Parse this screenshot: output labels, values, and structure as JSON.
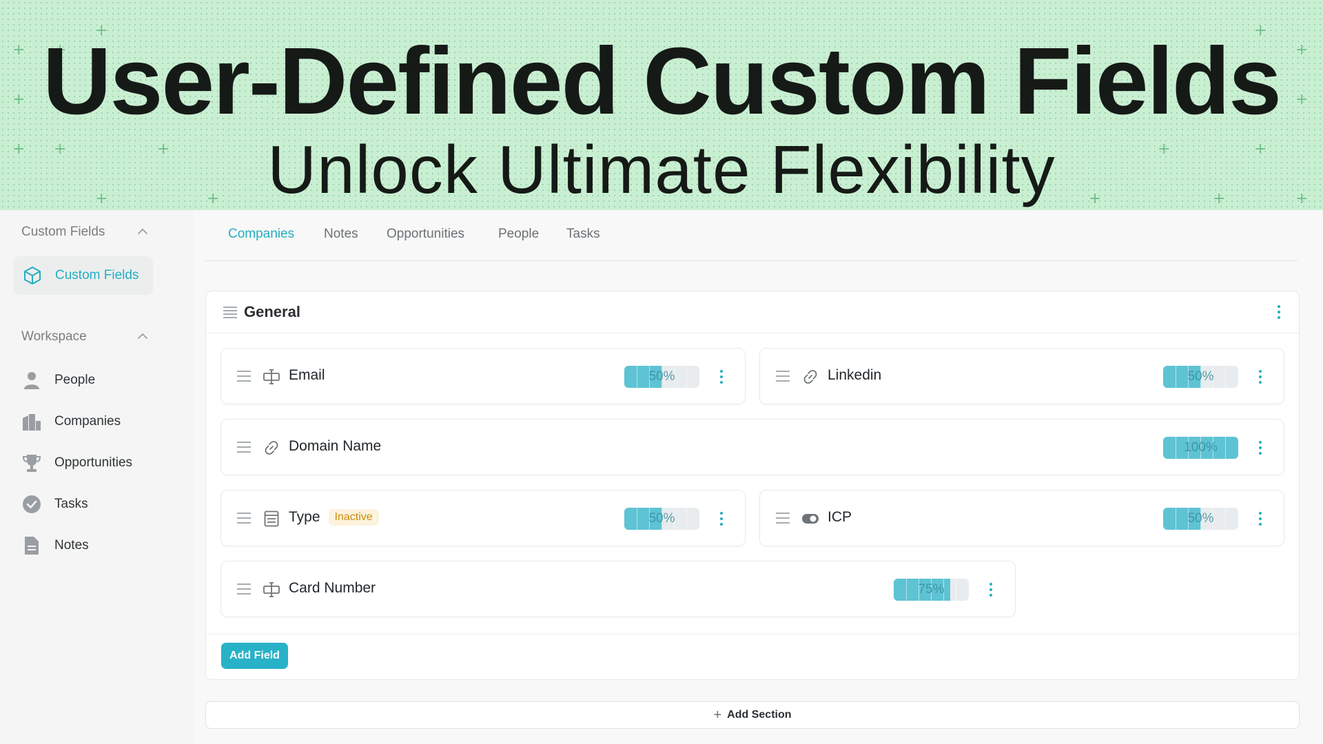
{
  "hero": {
    "title": "User-Defined Custom Fields",
    "subtitle": "Unlock Ultimate Flexibility"
  },
  "sidebar": {
    "groups": [
      {
        "label": "Custom Fields",
        "expanded": true
      },
      {
        "label": "Workspace",
        "expanded": true
      }
    ],
    "active_item": {
      "label": "Custom Fields",
      "icon": "cube-icon"
    },
    "items": [
      {
        "label": "People",
        "icon": "person-icon"
      },
      {
        "label": "Companies",
        "icon": "building-icon"
      },
      {
        "label": "Opportunities",
        "icon": "trophy-icon"
      },
      {
        "label": "Tasks",
        "icon": "check-circle-icon"
      },
      {
        "label": "Notes",
        "icon": "note-icon"
      }
    ]
  },
  "tabs": [
    {
      "label": "Companies",
      "active": true
    },
    {
      "label": "Notes",
      "active": false
    },
    {
      "label": "Opportunities",
      "active": false
    },
    {
      "label": "People",
      "active": false
    },
    {
      "label": "Tasks",
      "active": false
    }
  ],
  "section": {
    "title": "General",
    "fields": [
      {
        "name": "Email",
        "icon": "text-field-icon",
        "progress": 0.5,
        "progress_label": "50%"
      },
      {
        "name": "Linkedin",
        "icon": "link-icon",
        "progress": 0.5,
        "progress_label": "50%"
      },
      {
        "name": "Domain Name",
        "icon": "link-icon",
        "progress": 1.0,
        "progress_label": "100%"
      },
      {
        "name": "Type",
        "icon": "list-icon",
        "badge": "Inactive",
        "progress": 0.5,
        "progress_label": "50%"
      },
      {
        "name": "ICP",
        "icon": "toggle-icon",
        "progress": 0.5,
        "progress_label": "50%"
      },
      {
        "name": "Card Number",
        "icon": "text-field-icon",
        "progress": 0.75,
        "progress_label": "75%"
      }
    ],
    "add_field_label": "Add Field"
  },
  "add_section_label": "Add Section",
  "colors": {
    "accent": "#22aec4",
    "hero_bg": "#c9efd2",
    "meter_fill": "#5ec3d3",
    "badge_bg": "#fdf3dc",
    "badge_text": "#c98a10"
  }
}
